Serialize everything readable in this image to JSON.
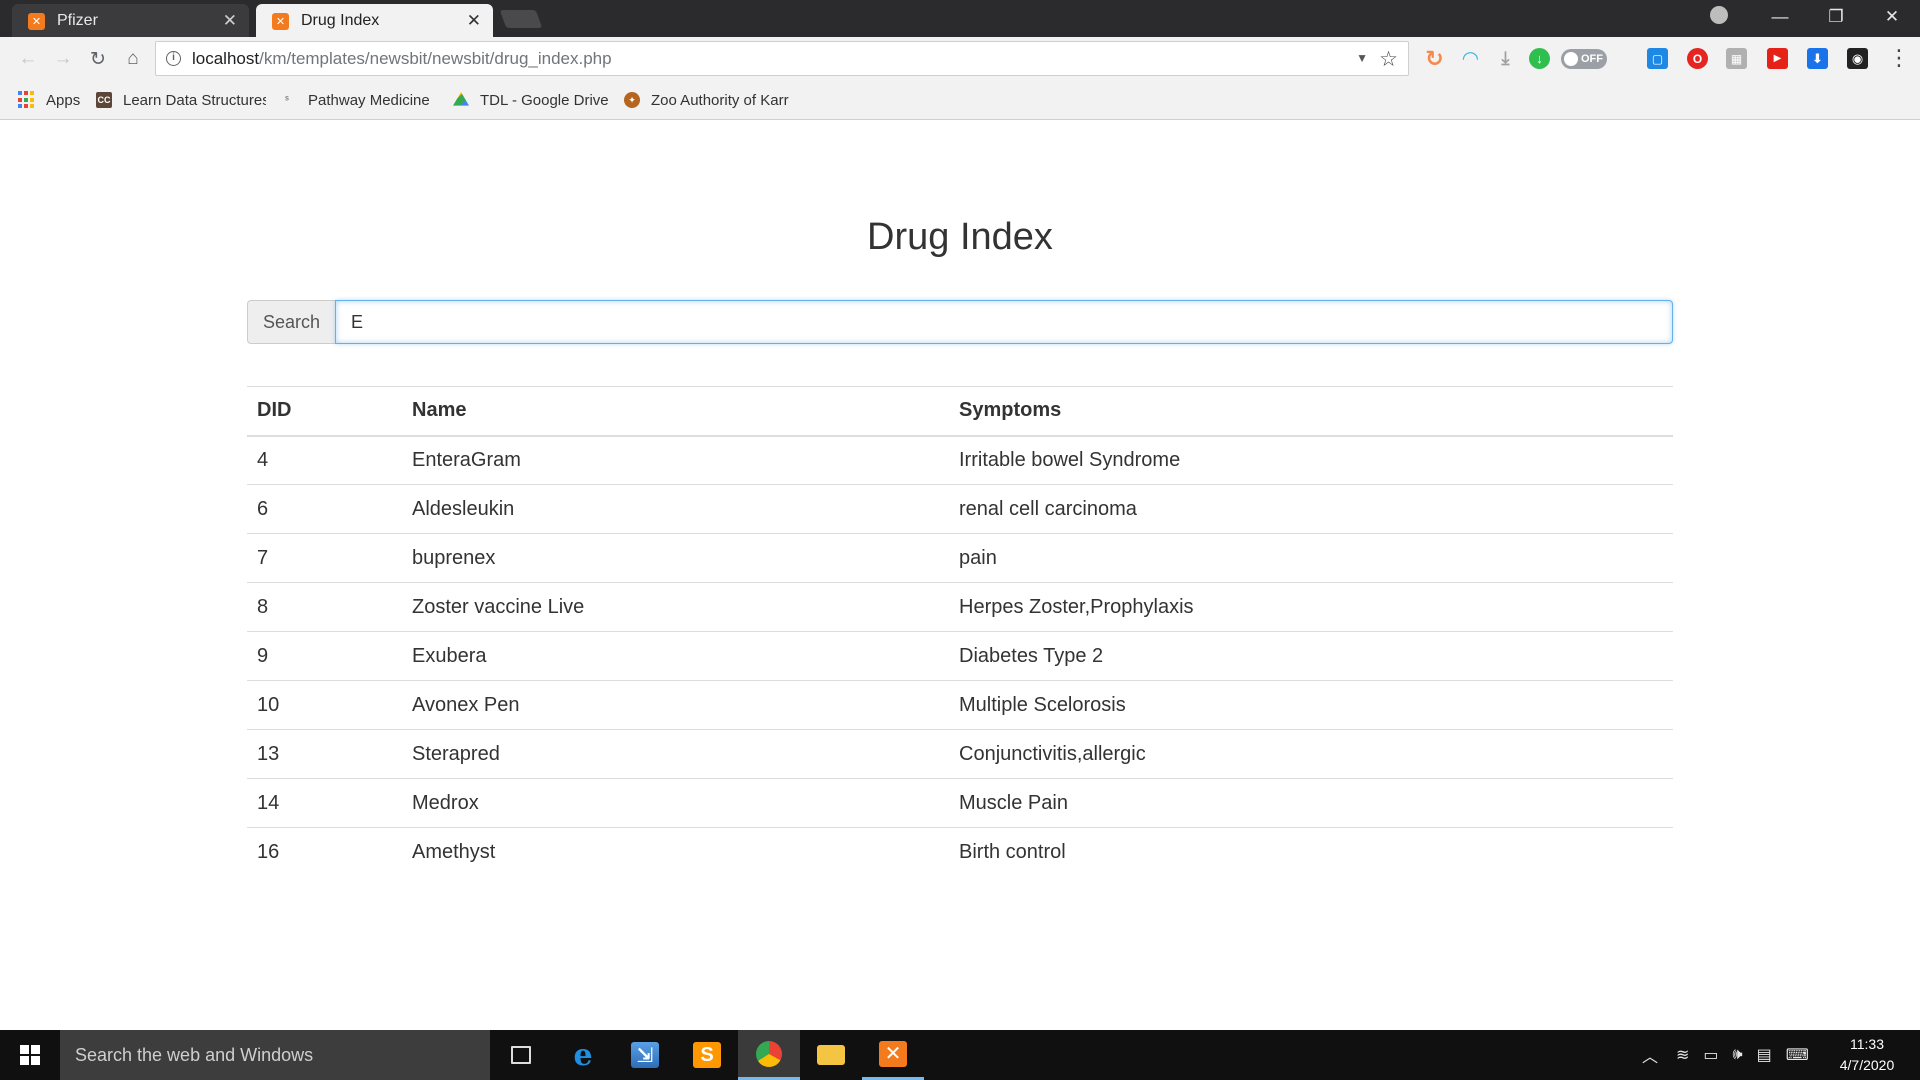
{
  "browser": {
    "tabs": [
      {
        "title": "Pfizer",
        "active": false,
        "favicon": "xampp-icon"
      },
      {
        "title": "Drug Index",
        "active": true,
        "favicon": "xampp-icon"
      }
    ],
    "url_host": "localhost",
    "url_path": "/km/templates/newsbit/newsbit/drug_index.php",
    "toggle_label": "OFF",
    "bookmarks": [
      {
        "label": "Apps",
        "icon": "apps-grid-icon"
      },
      {
        "label": "Learn Data Structures",
        "icon": "codechef-icon"
      },
      {
        "label": "Pathway Medicine",
        "icon": "pathway-icon"
      },
      {
        "label": "TDL - Google Drive",
        "icon": "google-drive-icon"
      },
      {
        "label": "Zoo Authority of Karr",
        "icon": "zoo-emblem-icon"
      }
    ]
  },
  "page": {
    "title": "Drug Index",
    "search": {
      "label": "Search",
      "value": "E"
    },
    "table": {
      "headers": [
        "DID",
        "Name",
        "Symptoms"
      ],
      "rows": [
        [
          "4",
          "EnteraGram",
          "Irritable bowel Syndrome"
        ],
        [
          "6",
          "Aldesleukin",
          "renal cell carcinoma"
        ],
        [
          "7",
          "buprenex",
          "pain"
        ],
        [
          "8",
          "Zoster vaccine Live",
          "Herpes Zoster,Prophylaxis"
        ],
        [
          "9",
          "Exubera",
          "Diabetes Type 2"
        ],
        [
          "10",
          "Avonex Pen",
          "Multiple Scelorosis"
        ],
        [
          "13",
          "Sterapred",
          "Conjunctivitis,allergic"
        ],
        [
          "14",
          "Medrox",
          "Muscle Pain"
        ],
        [
          "16",
          "Amethyst",
          "Birth control"
        ]
      ]
    }
  },
  "taskbar": {
    "search_placeholder": "Search the web and Windows",
    "time": "11:33",
    "date": "4/7/2020"
  },
  "colors": {
    "accent_focus": "#66afe9",
    "xampp_orange": "#f37b1d",
    "taskbar_bg": "#101010"
  }
}
